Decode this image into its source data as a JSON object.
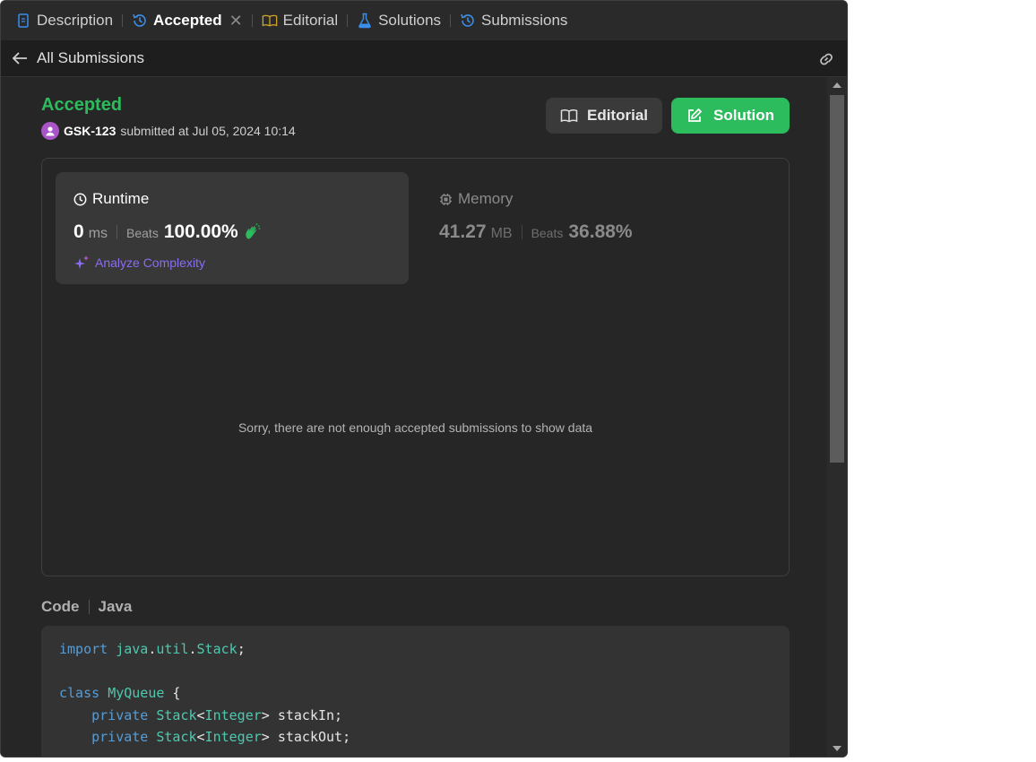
{
  "tabs": [
    {
      "label": "Description",
      "icon": "document-icon"
    },
    {
      "label": "Accepted",
      "icon": "history-icon",
      "active": true
    },
    {
      "label": "Editorial",
      "icon": "book-icon"
    },
    {
      "label": "Solutions",
      "icon": "flask-icon"
    },
    {
      "label": "Submissions",
      "icon": "history-icon"
    }
  ],
  "subheader": {
    "back_label": "All Submissions"
  },
  "submission": {
    "status": "Accepted",
    "user": "GSK-123",
    "submitted_text": "submitted at Jul 05, 2024 10:14"
  },
  "actions": {
    "editorial_label": "Editorial",
    "solution_label": "Solution"
  },
  "runtime": {
    "title": "Runtime",
    "value": "0",
    "unit": "ms",
    "beats_label": "Beats",
    "beats_pct": "100.00%",
    "analyze_label": "Analyze Complexity"
  },
  "memory": {
    "title": "Memory",
    "value": "41.27",
    "unit": "MB",
    "beats_label": "Beats",
    "beats_pct": "36.88%"
  },
  "no_data_text": "Sorry, there are not enough accepted submissions to show data",
  "code": {
    "label": "Code",
    "language": "Java",
    "lines": [
      "import java.util.Stack;",
      "",
      "class MyQueue {",
      "    private Stack<Integer> stackIn;",
      "    private Stack<Integer> stackOut;"
    ]
  },
  "colors": {
    "accepted": "#2cbb5d",
    "accent_blue": "#3b8eea",
    "analyze": "#8b6cf2",
    "background": "#262626"
  }
}
